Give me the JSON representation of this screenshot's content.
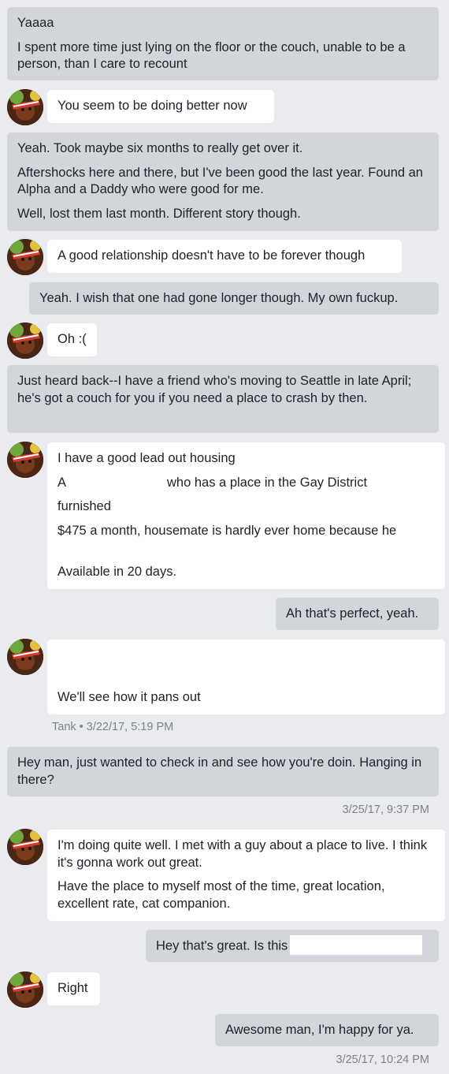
{
  "messages": {
    "m1": {
      "lines": [
        "Yaaaa",
        "I spent more time just lying on the floor or the couch, unable to be a person, than I care to recount"
      ]
    },
    "m2": {
      "lines": [
        "You seem to be doing better now"
      ]
    },
    "m3": {
      "lines": [
        "Yeah. Took maybe six months to really get over it.",
        "Aftershocks here and there, but I've been good the last year. Found an Alpha and a Daddy who were good for me.",
        "Well, lost them last month. Different story though."
      ]
    },
    "m4": {
      "lines": [
        "A good relationship doesn't have to be forever though"
      ]
    },
    "m5": {
      "lines": [
        "Yeah. I wish that one had gone longer though. My own fuckup."
      ]
    },
    "m6": {
      "lines": [
        "Oh :("
      ]
    },
    "m7": {
      "lines": [
        "Just heard back--I have a friend who's moving to Seattle in late April; he's got a couch for you if you need a place to crash by then."
      ]
    },
    "m8": {
      "line1": "I have a good lead out housing",
      "line2_start": "A",
      "line2_end": "who has a place in the Gay District",
      "line3": "furnished",
      "line4": "$475 a month, housemate is hardly ever home because he",
      "line5": "Available in 20 days."
    },
    "m9": {
      "lines": [
        "Ah that's perfect, yeah."
      ]
    },
    "m10": {
      "lines": [
        "We'll see how it pans out"
      ]
    },
    "m11": {
      "lines": [
        "Hey man, just wanted to check in and see how you're doin. Hanging in there?"
      ]
    },
    "m12": {
      "lines": [
        "I'm doing quite well. I met with a guy about a place to live. I think it's gonna work out great.",
        "Have the place to myself most of the time, great location, excellent rate, cat companion."
      ]
    },
    "m13": {
      "text": "Hey that's great. Is this"
    },
    "m14": {
      "lines": [
        "Right"
      ]
    },
    "m15": {
      "lines": [
        "Awesome man, I'm happy for ya."
      ]
    }
  },
  "stamps": {
    "s1": "Tank • 3/22/17, 5:19 PM",
    "s2": "3/25/17, 9:37 PM",
    "s3": "3/25/17, 10:24 PM"
  },
  "colors": {
    "background": "#e9ebee",
    "outgoing_bubble": "#d2d6da",
    "incoming_bubble": "#ffffff",
    "timestamp": "#7f8388"
  },
  "icons": {
    "avatar": "avatar-icon"
  }
}
